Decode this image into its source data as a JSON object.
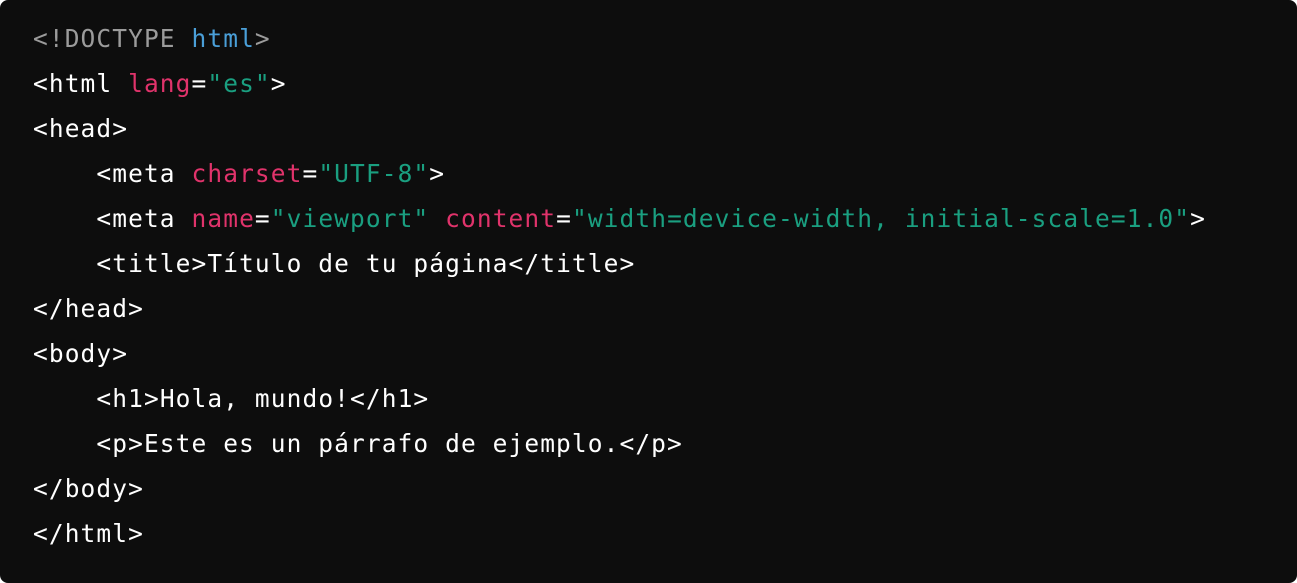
{
  "colors": {
    "background": "#0d0d0d",
    "plain": "#ffffff",
    "doctype": "#9b9b9b",
    "keyword": "#4a9fd8",
    "attribute": "#e0336b",
    "string": "#1a9f80"
  },
  "code": {
    "lines": [
      [
        {
          "t": "doctype",
          "v": "<!DOCTYPE "
        },
        {
          "t": "kw",
          "v": "html"
        },
        {
          "t": "doctype",
          "v": ">"
        }
      ],
      [
        {
          "t": "plain",
          "v": "<html "
        },
        {
          "t": "attr",
          "v": "lang"
        },
        {
          "t": "plain",
          "v": "="
        },
        {
          "t": "str",
          "v": "\"es\""
        },
        {
          "t": "plain",
          "v": ">"
        }
      ],
      [
        {
          "t": "plain",
          "v": "<head>"
        }
      ],
      [
        {
          "t": "plain",
          "v": "    <meta "
        },
        {
          "t": "attr",
          "v": "charset"
        },
        {
          "t": "plain",
          "v": "="
        },
        {
          "t": "str",
          "v": "\"UTF-8\""
        },
        {
          "t": "plain",
          "v": ">"
        }
      ],
      [
        {
          "t": "plain",
          "v": "    <meta "
        },
        {
          "t": "attr",
          "v": "name"
        },
        {
          "t": "plain",
          "v": "="
        },
        {
          "t": "str",
          "v": "\"viewport\""
        },
        {
          "t": "plain",
          "v": " "
        },
        {
          "t": "attr",
          "v": "content"
        },
        {
          "t": "plain",
          "v": "="
        },
        {
          "t": "str",
          "v": "\"width=device-width, initial-scale=1.0\""
        },
        {
          "t": "plain",
          "v": ">"
        }
      ],
      [
        {
          "t": "plain",
          "v": "    <title>"
        },
        {
          "t": "text",
          "v": "Título de tu página"
        },
        {
          "t": "plain",
          "v": "</title>"
        }
      ],
      [
        {
          "t": "plain",
          "v": "</head>"
        }
      ],
      [
        {
          "t": "plain",
          "v": "<body>"
        }
      ],
      [
        {
          "t": "plain",
          "v": "    <h1>"
        },
        {
          "t": "text",
          "v": "Hola, mundo!"
        },
        {
          "t": "plain",
          "v": "</h1>"
        }
      ],
      [
        {
          "t": "plain",
          "v": "    <p>"
        },
        {
          "t": "text",
          "v": "Este es un párrafo de ejemplo."
        },
        {
          "t": "plain",
          "v": "</p>"
        }
      ],
      [
        {
          "t": "plain",
          "v": "</body>"
        }
      ],
      [
        {
          "t": "plain",
          "v": "</html>"
        }
      ]
    ]
  }
}
